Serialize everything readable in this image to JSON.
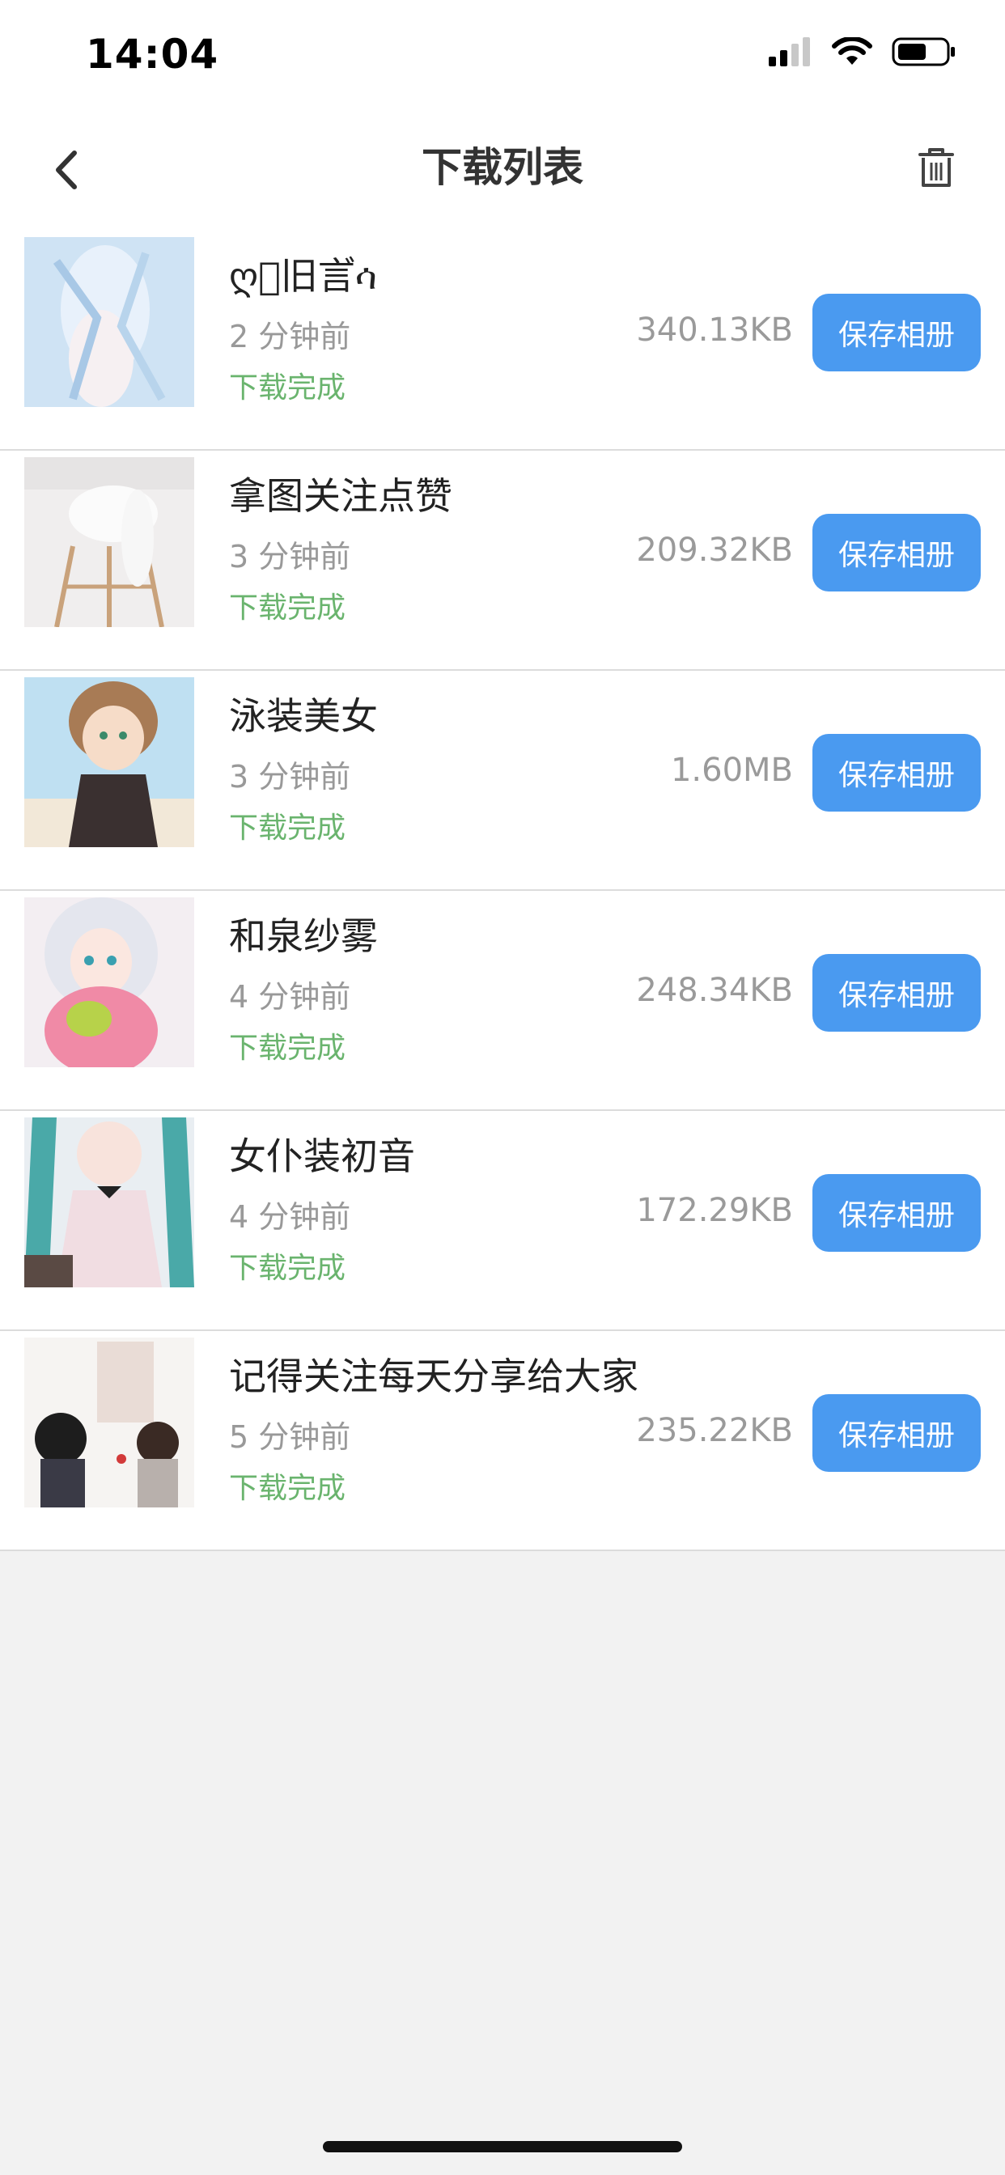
{
  "status_bar": {
    "time": "14:04"
  },
  "nav": {
    "title": "下载列表"
  },
  "items": [
    {
      "title": "ღ゚旧言゙ሳ",
      "time": "2 分钟前",
      "size": "340.13KB",
      "status": "下载完成",
      "button": "保存相册"
    },
    {
      "title": "拿图关注点赞",
      "time": "3 分钟前",
      "size": "209.32KB",
      "status": "下载完成",
      "button": "保存相册"
    },
    {
      "title": "泳装美女",
      "time": "3 分钟前",
      "size": "1.60MB",
      "status": "下载完成",
      "button": "保存相册"
    },
    {
      "title": "和泉纱雾",
      "time": "4 分钟前",
      "size": "248.34KB",
      "status": "下载完成",
      "button": "保存相册"
    },
    {
      "title": "女仆装初音",
      "time": "4 分钟前",
      "size": "172.29KB",
      "status": "下载完成",
      "button": "保存相册"
    },
    {
      "title": "记得关注每天分享给大家",
      "time": "5 分钟前",
      "size": "235.22KB",
      "status": "下载完成",
      "button": "保存相册"
    }
  ],
  "colors": {
    "accent": "#4a9af0",
    "status_green": "#6ab46e",
    "muted_text": "#999999",
    "background": "#f2f2f2"
  }
}
